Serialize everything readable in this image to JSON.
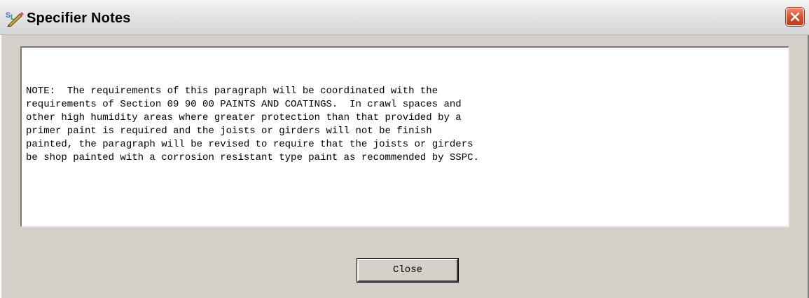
{
  "window": {
    "title": "Specifier Notes",
    "app_icon": "sl-app-icon",
    "close_icon": "close-icon",
    "accent_close": "#d9502c"
  },
  "notes": {
    "lines": [
      "NOTE:  The requirements of this paragraph will be coordinated with the",
      "requirements of Section 09 90 00 PAINTS AND COATINGS.  In crawl spaces and",
      "other high humidity areas where greater protection than that provided by a",
      "primer paint is required and the joists or girders will not be finish",
      "painted, the paragraph will be revised to require that the joists or girders",
      "be shop painted with a corrosion resistant type paint as recommended by SSPC."
    ]
  },
  "buttons": {
    "close_label": "Close"
  }
}
